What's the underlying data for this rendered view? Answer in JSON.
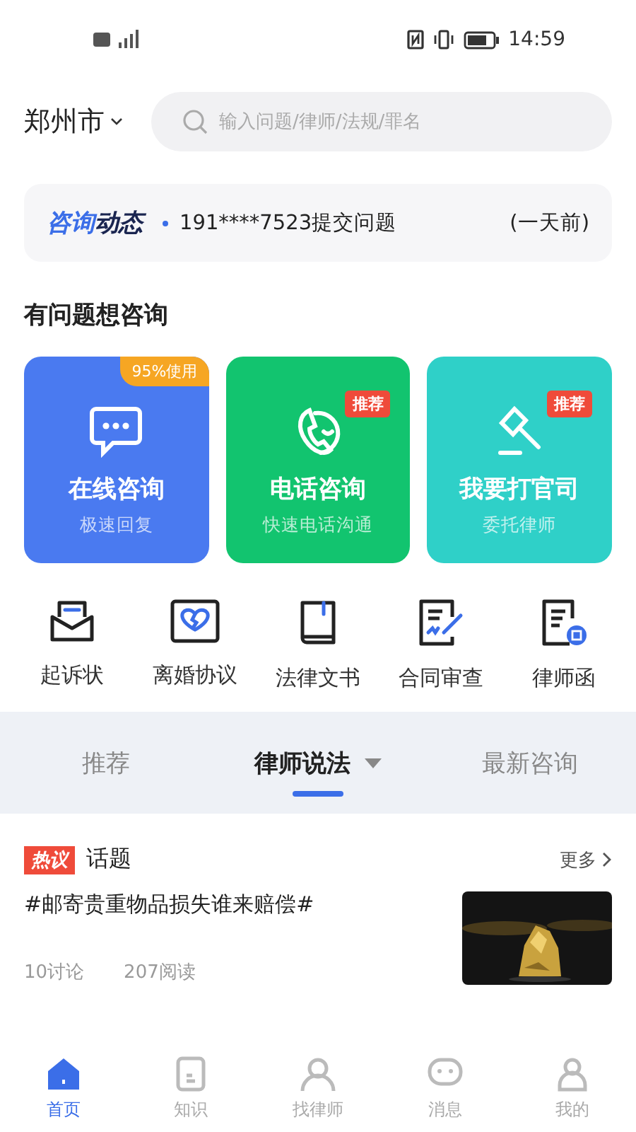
{
  "status_bar": {
    "time": "14:59"
  },
  "header": {
    "city": "郑州市",
    "search": {
      "placeholder": "输入问题/律师/法规/罪名"
    }
  },
  "ticker": {
    "brand_a": "咨询",
    "brand_b": "动态",
    "message": "191****7523提交问题",
    "time": "(一天前)"
  },
  "section_title": "有问题想咨询",
  "services": [
    {
      "kind": "chat",
      "title": "在线咨询",
      "subtitle": "极速回复",
      "badge": {
        "text": "95%使用",
        "kind": "corner"
      },
      "color": "#4a7af0"
    },
    {
      "kind": "phone",
      "title": "电话咨询",
      "subtitle": "快速电话沟通",
      "badge": {
        "text": "推荐",
        "kind": "tag"
      },
      "color": "#12c46f"
    },
    {
      "kind": "gavel",
      "title": "我要打官司",
      "subtitle": "委托律师",
      "badge": {
        "text": "推荐",
        "kind": "tag"
      },
      "color": "#2fd0c8"
    }
  ],
  "tools": [
    {
      "kind": "mail",
      "label": "起诉状"
    },
    {
      "kind": "heart",
      "label": "离婚协议"
    },
    {
      "kind": "book",
      "label": "法律文书"
    },
    {
      "kind": "sign",
      "label": "合同审查"
    },
    {
      "kind": "letter",
      "label": "律师函"
    }
  ],
  "tabs": [
    {
      "label": "推荐",
      "selected": false,
      "dropdown": false
    },
    {
      "label": "律师说法",
      "selected": true,
      "dropdown": true
    },
    {
      "label": "最新咨询",
      "selected": false,
      "dropdown": false
    }
  ],
  "topics": {
    "tag": "热议",
    "title": "话题",
    "more": "更多",
    "items": [
      {
        "title": "#邮寄贵重物品损失谁来赔偿#",
        "discussions": "10讨论",
        "reads": "207阅读"
      }
    ]
  },
  "bottom_nav": [
    {
      "label": "首页",
      "kind": "home",
      "selected": true
    },
    {
      "label": "知识",
      "kind": "doc",
      "selected": false
    },
    {
      "label": "找律师",
      "kind": "person",
      "selected": false
    },
    {
      "label": "消息",
      "kind": "chat",
      "selected": false
    },
    {
      "label": "我的",
      "kind": "user",
      "selected": false
    }
  ]
}
